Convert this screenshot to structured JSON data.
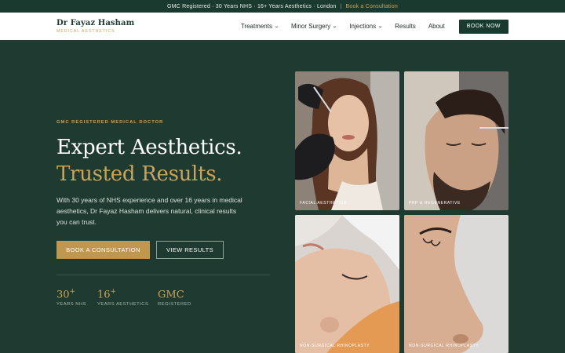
{
  "topbar": {
    "info": "GMC Registered · 30 Years NHS · 16+ Years Aesthetics · London",
    "separator": "|",
    "cta": "Book a Consultation"
  },
  "brand": {
    "name": "Dr Fayaz Hasham",
    "tagline": "MEDICAL AESTHETICS"
  },
  "nav": {
    "items": [
      {
        "label": "Treatments",
        "has_dropdown": true
      },
      {
        "label": "Minor Surgery",
        "has_dropdown": true
      },
      {
        "label": "Injections",
        "has_dropdown": true
      },
      {
        "label": "Results",
        "has_dropdown": false
      },
      {
        "label": "About",
        "has_dropdown": false
      }
    ],
    "book_label": "BOOK NOW"
  },
  "hero": {
    "eyebrow": "GMC REGISTERED MEDICAL DOCTOR",
    "title_line1": "Expert Aesthetics.",
    "title_line2": "Trusted Results.",
    "lead": "With 30 years of NHS experience and over 16 years in medical aesthetics, Dr Fayaz Hasham delivers natural, clinical results you can trust.",
    "primary_cta": "BOOK A CONSULTATION",
    "secondary_cta": "VIEW RESULTS",
    "stats": [
      {
        "value": "30",
        "suffix": "+",
        "label": "YEARS NHS"
      },
      {
        "value": "16",
        "suffix": "+",
        "label": "YEARS AESTHETICS"
      },
      {
        "value": "GMC",
        "suffix": "",
        "label": "REGISTERED"
      }
    ]
  },
  "gallery": [
    {
      "caption": "FACIAL AESTHETICS"
    },
    {
      "caption": "PRP & REGENERATIVE"
    },
    {
      "caption": "NON-SURGICAL RHINOPLASTY"
    },
    {
      "caption": "NON-SURGICAL RHINOPLASTY"
    }
  ],
  "colors": {
    "primary_green": "#1b3a2f",
    "hero_bg": "#1e3a31",
    "gold": "#c9a45a",
    "button_gold": "#c0974f"
  },
  "icons": {
    "dropdown": "chevron-down-icon"
  }
}
